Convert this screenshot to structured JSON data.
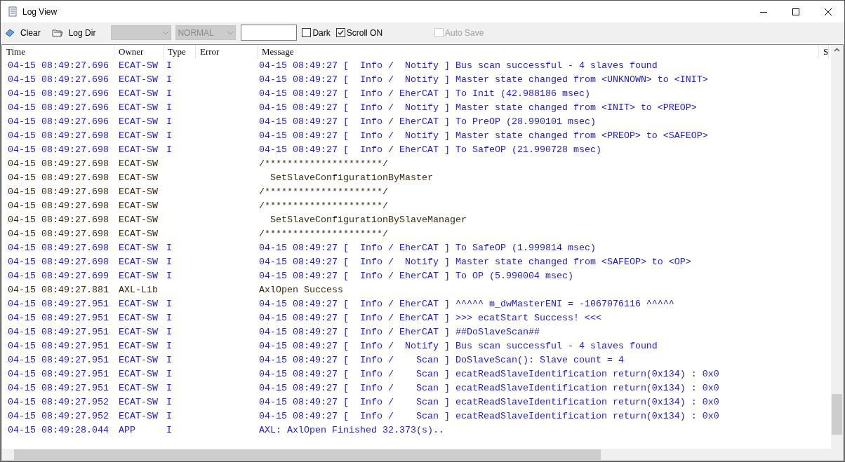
{
  "window": {
    "title": "Log View"
  },
  "toolbar": {
    "buttons": [
      {
        "label": "Clear",
        "kind": "clear"
      },
      {
        "label": "Log Dir",
        "kind": "folder"
      }
    ],
    "combos": [
      {
        "disabled": true
      },
      {
        "value": "NORMAL",
        "disabled": true
      }
    ],
    "checkboxes": [
      {
        "label": "Dark",
        "checked": false,
        "disabled": false
      },
      {
        "label": "Scroll ON",
        "checked": true,
        "disabled": false
      },
      {
        "label": "Auto Save",
        "checked": false,
        "disabled": true
      }
    ]
  },
  "table": {
    "columns": [
      "Time",
      "Owner",
      "Type",
      "Error",
      "Message",
      "S"
    ],
    "rows": [
      {
        "kind": "info",
        "time": "04-15 08:49:27.696",
        "owner": "ECAT-SW",
        "type": "I",
        "message": "04-15 08:49:27 [  Info /  Notify ] Bus scan successful - 4 slaves found"
      },
      {
        "kind": "info",
        "time": "04-15 08:49:27.696",
        "owner": "ECAT-SW",
        "type": "I",
        "message": "04-15 08:49:27 [  Info /  Notify ] Master state changed from <UNKNOWN> to <INIT>"
      },
      {
        "kind": "info",
        "time": "04-15 08:49:27.696",
        "owner": "ECAT-SW",
        "type": "I",
        "message": "04-15 08:49:27 [  Info / EherCAT ] To Init (42.988186 msec)"
      },
      {
        "kind": "info",
        "time": "04-15 08:49:27.696",
        "owner": "ECAT-SW",
        "type": "I",
        "message": "04-15 08:49:27 [  Info /  Notify ] Master state changed from <INIT> to <PREOP>"
      },
      {
        "kind": "info",
        "time": "04-15 08:49:27.696",
        "owner": "ECAT-SW",
        "type": "I",
        "message": "04-15 08:49:27 [  Info / EherCAT ] To PreOP (28.990101 msec)"
      },
      {
        "kind": "info",
        "time": "04-15 08:49:27.698",
        "owner": "ECAT-SW",
        "type": "I",
        "message": "04-15 08:49:27 [  Info /  Notify ] Master state changed from <PREOP> to <SAFEOP>"
      },
      {
        "kind": "info",
        "time": "04-15 08:49:27.698",
        "owner": "ECAT-SW",
        "type": "I",
        "message": "04-15 08:49:27 [  Info / EherCAT ] To SafeOP (21.990728 msec)"
      },
      {
        "kind": "plain",
        "time": "04-15 08:49:27.698",
        "owner": "ECAT-SW",
        "message": "/*********************/"
      },
      {
        "kind": "plain",
        "time": "04-15 08:49:27.698",
        "owner": "ECAT-SW",
        "message": "  SetSlaveConfigurationByMaster"
      },
      {
        "kind": "plain",
        "time": "04-15 08:49:27.698",
        "owner": "ECAT-SW",
        "message": "/*********************/"
      },
      {
        "kind": "plain",
        "time": "04-15 08:49:27.698",
        "owner": "ECAT-SW",
        "message": "/*********************/"
      },
      {
        "kind": "plain",
        "time": "04-15 08:49:27.698",
        "owner": "ECAT-SW",
        "message": "  SetSlaveConfigurationBySlaveManager"
      },
      {
        "kind": "plain",
        "time": "04-15 08:49:27.698",
        "owner": "ECAT-SW",
        "message": "/*********************/"
      },
      {
        "kind": "info",
        "time": "04-15 08:49:27.698",
        "owner": "ECAT-SW",
        "type": "I",
        "message": "04-15 08:49:27 [  Info / EherCAT ] To SafeOP (1.999814 msec)"
      },
      {
        "kind": "info",
        "time": "04-15 08:49:27.698",
        "owner": "ECAT-SW",
        "type": "I",
        "message": "04-15 08:49:27 [  Info /  Notify ] Master state changed from <SAFEOP> to <OP>"
      },
      {
        "kind": "info",
        "time": "04-15 08:49:27.699",
        "owner": "ECAT-SW",
        "type": "I",
        "message": "04-15 08:49:27 [  Info / EherCAT ] To OP (5.990004 msec)"
      },
      {
        "kind": "plain",
        "time": "04-15 08:49:27.881",
        "owner": "AXL-Lib",
        "message": "AxlOpen Success"
      },
      {
        "kind": "info",
        "time": "04-15 08:49:27.951",
        "owner": "ECAT-SW",
        "type": "I",
        "message": "04-15 08:49:27 [  Info / EherCAT ] ^^^^^ m_dwMasterENI = -1067076116 ^^^^^"
      },
      {
        "kind": "info",
        "time": "04-15 08:49:27.951",
        "owner": "ECAT-SW",
        "type": "I",
        "message": "04-15 08:49:27 [  Info / EherCAT ] >>> ecatStart Success! <<<"
      },
      {
        "kind": "info",
        "time": "04-15 08:49:27.951",
        "owner": "ECAT-SW",
        "type": "I",
        "message": "04-15 08:49:27 [  Info / EherCAT ] ##DoSlaveScan##"
      },
      {
        "kind": "info",
        "time": "04-15 08:49:27.951",
        "owner": "ECAT-SW",
        "type": "I",
        "message": "04-15 08:49:27 [  Info /  Notify ] Bus scan successful - 4 slaves found"
      },
      {
        "kind": "info",
        "time": "04-15 08:49:27.951",
        "owner": "ECAT-SW",
        "type": "I",
        "message": "04-15 08:49:27 [  Info /    Scan ] DoSlaveScan(): Slave count = 4"
      },
      {
        "kind": "info",
        "time": "04-15 08:49:27.951",
        "owner": "ECAT-SW",
        "type": "I",
        "message": "04-15 08:49:27 [  Info /    Scan ] ecatReadSlaveIdentification return(0x134) : 0x0"
      },
      {
        "kind": "info",
        "time": "04-15 08:49:27.951",
        "owner": "ECAT-SW",
        "type": "I",
        "message": "04-15 08:49:27 [  Info /    Scan ] ecatReadSlaveIdentification return(0x134) : 0x0"
      },
      {
        "kind": "info",
        "time": "04-15 08:49:27.952",
        "owner": "ECAT-SW",
        "type": "I",
        "message": "04-15 08:49:27 [  Info /    Scan ] ecatReadSlaveIdentification return(0x134) : 0x0"
      },
      {
        "kind": "info",
        "time": "04-15 08:49:27.952",
        "owner": "ECAT-SW",
        "type": "I",
        "message": "04-15 08:49:27 [  Info /    Scan ] ecatReadSlaveIdentification return(0x134) : 0x0"
      },
      {
        "kind": "info",
        "time": "04-15 08:49:28.044",
        "owner": "APP",
        "type": "I",
        "message": "AXL: AxlOpen Finished 32.373(s).."
      }
    ]
  }
}
